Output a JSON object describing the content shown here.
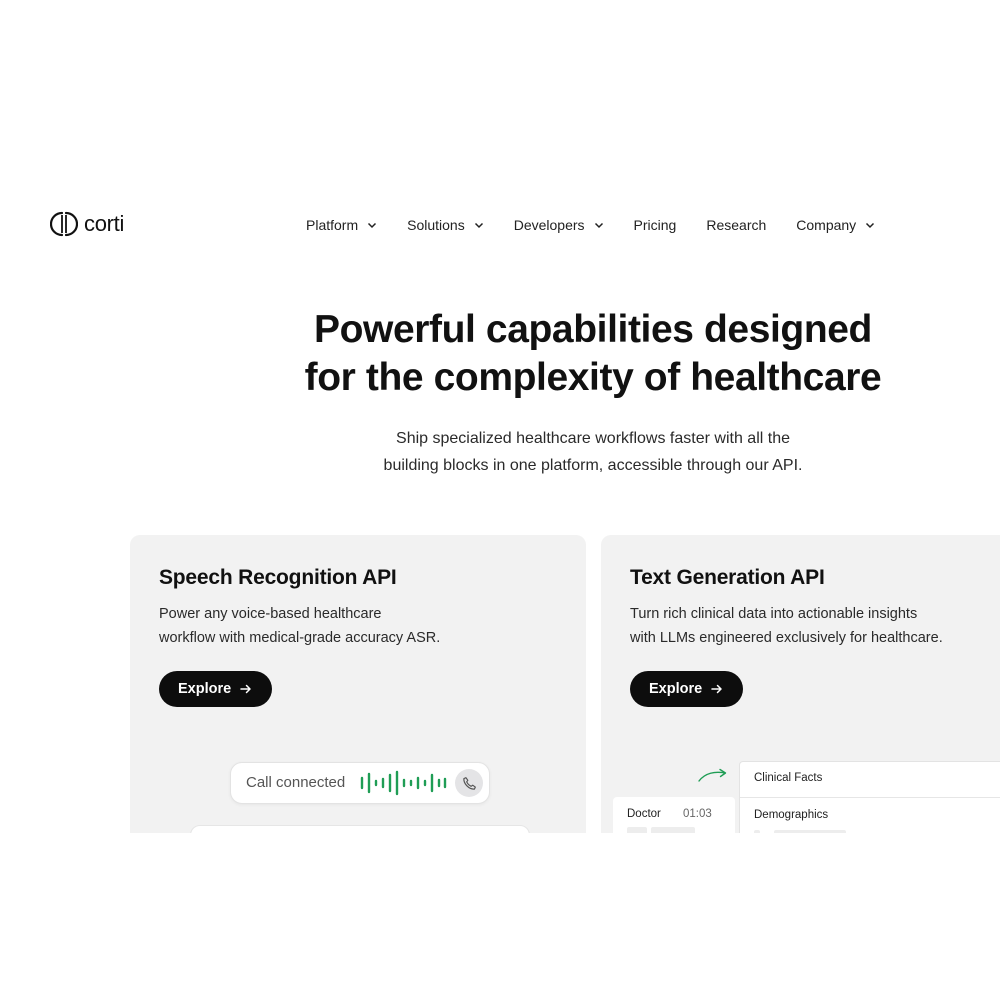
{
  "brand": {
    "name": "corti"
  },
  "nav": [
    {
      "label": "Platform",
      "dropdown": true
    },
    {
      "label": "Solutions",
      "dropdown": true
    },
    {
      "label": "Developers",
      "dropdown": true
    },
    {
      "label": "Pricing",
      "dropdown": false
    },
    {
      "label": "Research",
      "dropdown": false
    },
    {
      "label": "Company",
      "dropdown": true
    }
  ],
  "hero": {
    "title_line1": "Powerful capabilities designed",
    "title_line2": "for the complexity of healthcare",
    "subtitle_line1": "Ship specialized healthcare workflows faster with all the",
    "subtitle_line2": "building blocks in one platform, accessible through our API."
  },
  "cards": [
    {
      "title": "Speech Recognition API",
      "desc_line1": "Power any voice-based healthcare",
      "desc_line2": "workflow with medical-grade accuracy ASR.",
      "button": "Explore",
      "widget": {
        "call_status": "Call connected"
      }
    },
    {
      "title": "Text Generation API",
      "desc_line1": "Turn rich clinical data into actionable insights",
      "desc_line2": "with LLMs engineered exclusively for healthcare.",
      "button": "Explore",
      "widget": {
        "doctor_label": "Doctor",
        "doctor_time": "01:03",
        "facts_heading": "Clinical Facts",
        "demographics_label": "Demographics"
      }
    }
  ],
  "colors": {
    "accent_green": "#1f9d55",
    "button_bg": "#0d0d0d",
    "card_bg": "#f2f2f2"
  },
  "icons": {
    "nav_dropdown": "chevron-down-icon",
    "button": "arrow-right-icon",
    "call": "phone-icon"
  }
}
